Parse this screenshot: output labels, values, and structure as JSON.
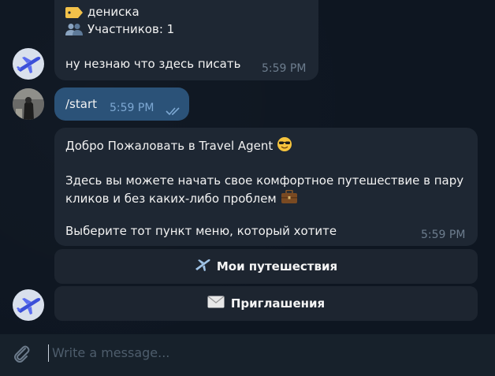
{
  "message_1": {
    "line_1": "дениска",
    "line_2": "Участников: 1",
    "line_3": "ну незнаю что здесь писать",
    "time": "5:59 PM"
  },
  "message_2": {
    "text": "/start",
    "time": "5:59 PM"
  },
  "message_3": {
    "line_1": "Добро Пожаловать в Travel Agent",
    "line_2": "Здесь вы можете начать свое комфортное путешествие в пару",
    "line_3": "кликов и без каких-либо проблем",
    "line_4": "Выберите тот пункт меню, который хотите",
    "time": "5:59 PM"
  },
  "keyboard": {
    "button_1": "Мои путешествия",
    "button_2": "Приглашения"
  },
  "composer": {
    "placeholder": "Write a message..."
  },
  "colors": {
    "background": "#0e1621",
    "incoming_bubble": "#1e2733",
    "outgoing_bubble": "#2b5278",
    "composer": "#17212b"
  }
}
